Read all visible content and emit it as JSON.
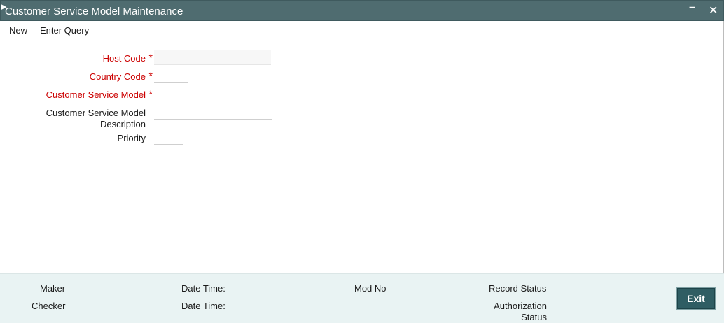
{
  "window": {
    "title": "Customer Service Model Maintenance",
    "minimize_glyph": "−",
    "close_glyph": "✕"
  },
  "menu": {
    "new_label": "New",
    "enter_query_label": "Enter Query"
  },
  "form": {
    "host_code": {
      "label": "Host Code",
      "required": "*",
      "value": ""
    },
    "country_code": {
      "label": "Country Code",
      "required": "*",
      "value": ""
    },
    "customer_service_model": {
      "label": "Customer Service Model",
      "required": "*",
      "value": ""
    },
    "description": {
      "label_line1": "Customer Service Model",
      "label_line2": "Description",
      "value": ""
    },
    "priority": {
      "label": "Priority",
      "value": ""
    }
  },
  "footer": {
    "maker_label": "Maker",
    "checker_label": "Checker",
    "date_time_label_1": "Date Time:",
    "date_time_label_2": "Date Time:",
    "mod_no_label": "Mod No",
    "record_status_label": "Record Status",
    "authorization_status_line1": "Authorization",
    "authorization_status_line2": "Status",
    "exit_label": "Exit"
  },
  "colors": {
    "titlebar": "#4f6c70",
    "required_label": "#cc0000",
    "footer_bg": "#e9f3f3",
    "exit_button": "#2f5d63"
  }
}
